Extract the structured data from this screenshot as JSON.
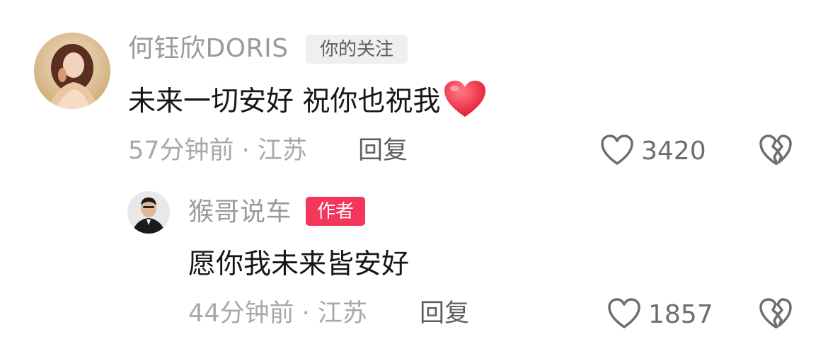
{
  "comments": [
    {
      "username": "何钰欣DORIS",
      "tag": "你的关注",
      "text": "未来一切安好 祝你也祝我",
      "emoji": "red-heart",
      "time_location": "57分钟前 · 江苏",
      "reply_label": "回复",
      "likes": "3420"
    },
    {
      "username": "猴哥说车",
      "tag": "作者",
      "text": "愿你我未来皆安好",
      "time_location": "44分钟前 · 江苏",
      "reply_label": "回复",
      "likes": "1857"
    }
  ],
  "colors": {
    "author_tag": "#f5365c",
    "follow_tag_bg": "#efefef",
    "meta_text": "#a8a8a8"
  }
}
